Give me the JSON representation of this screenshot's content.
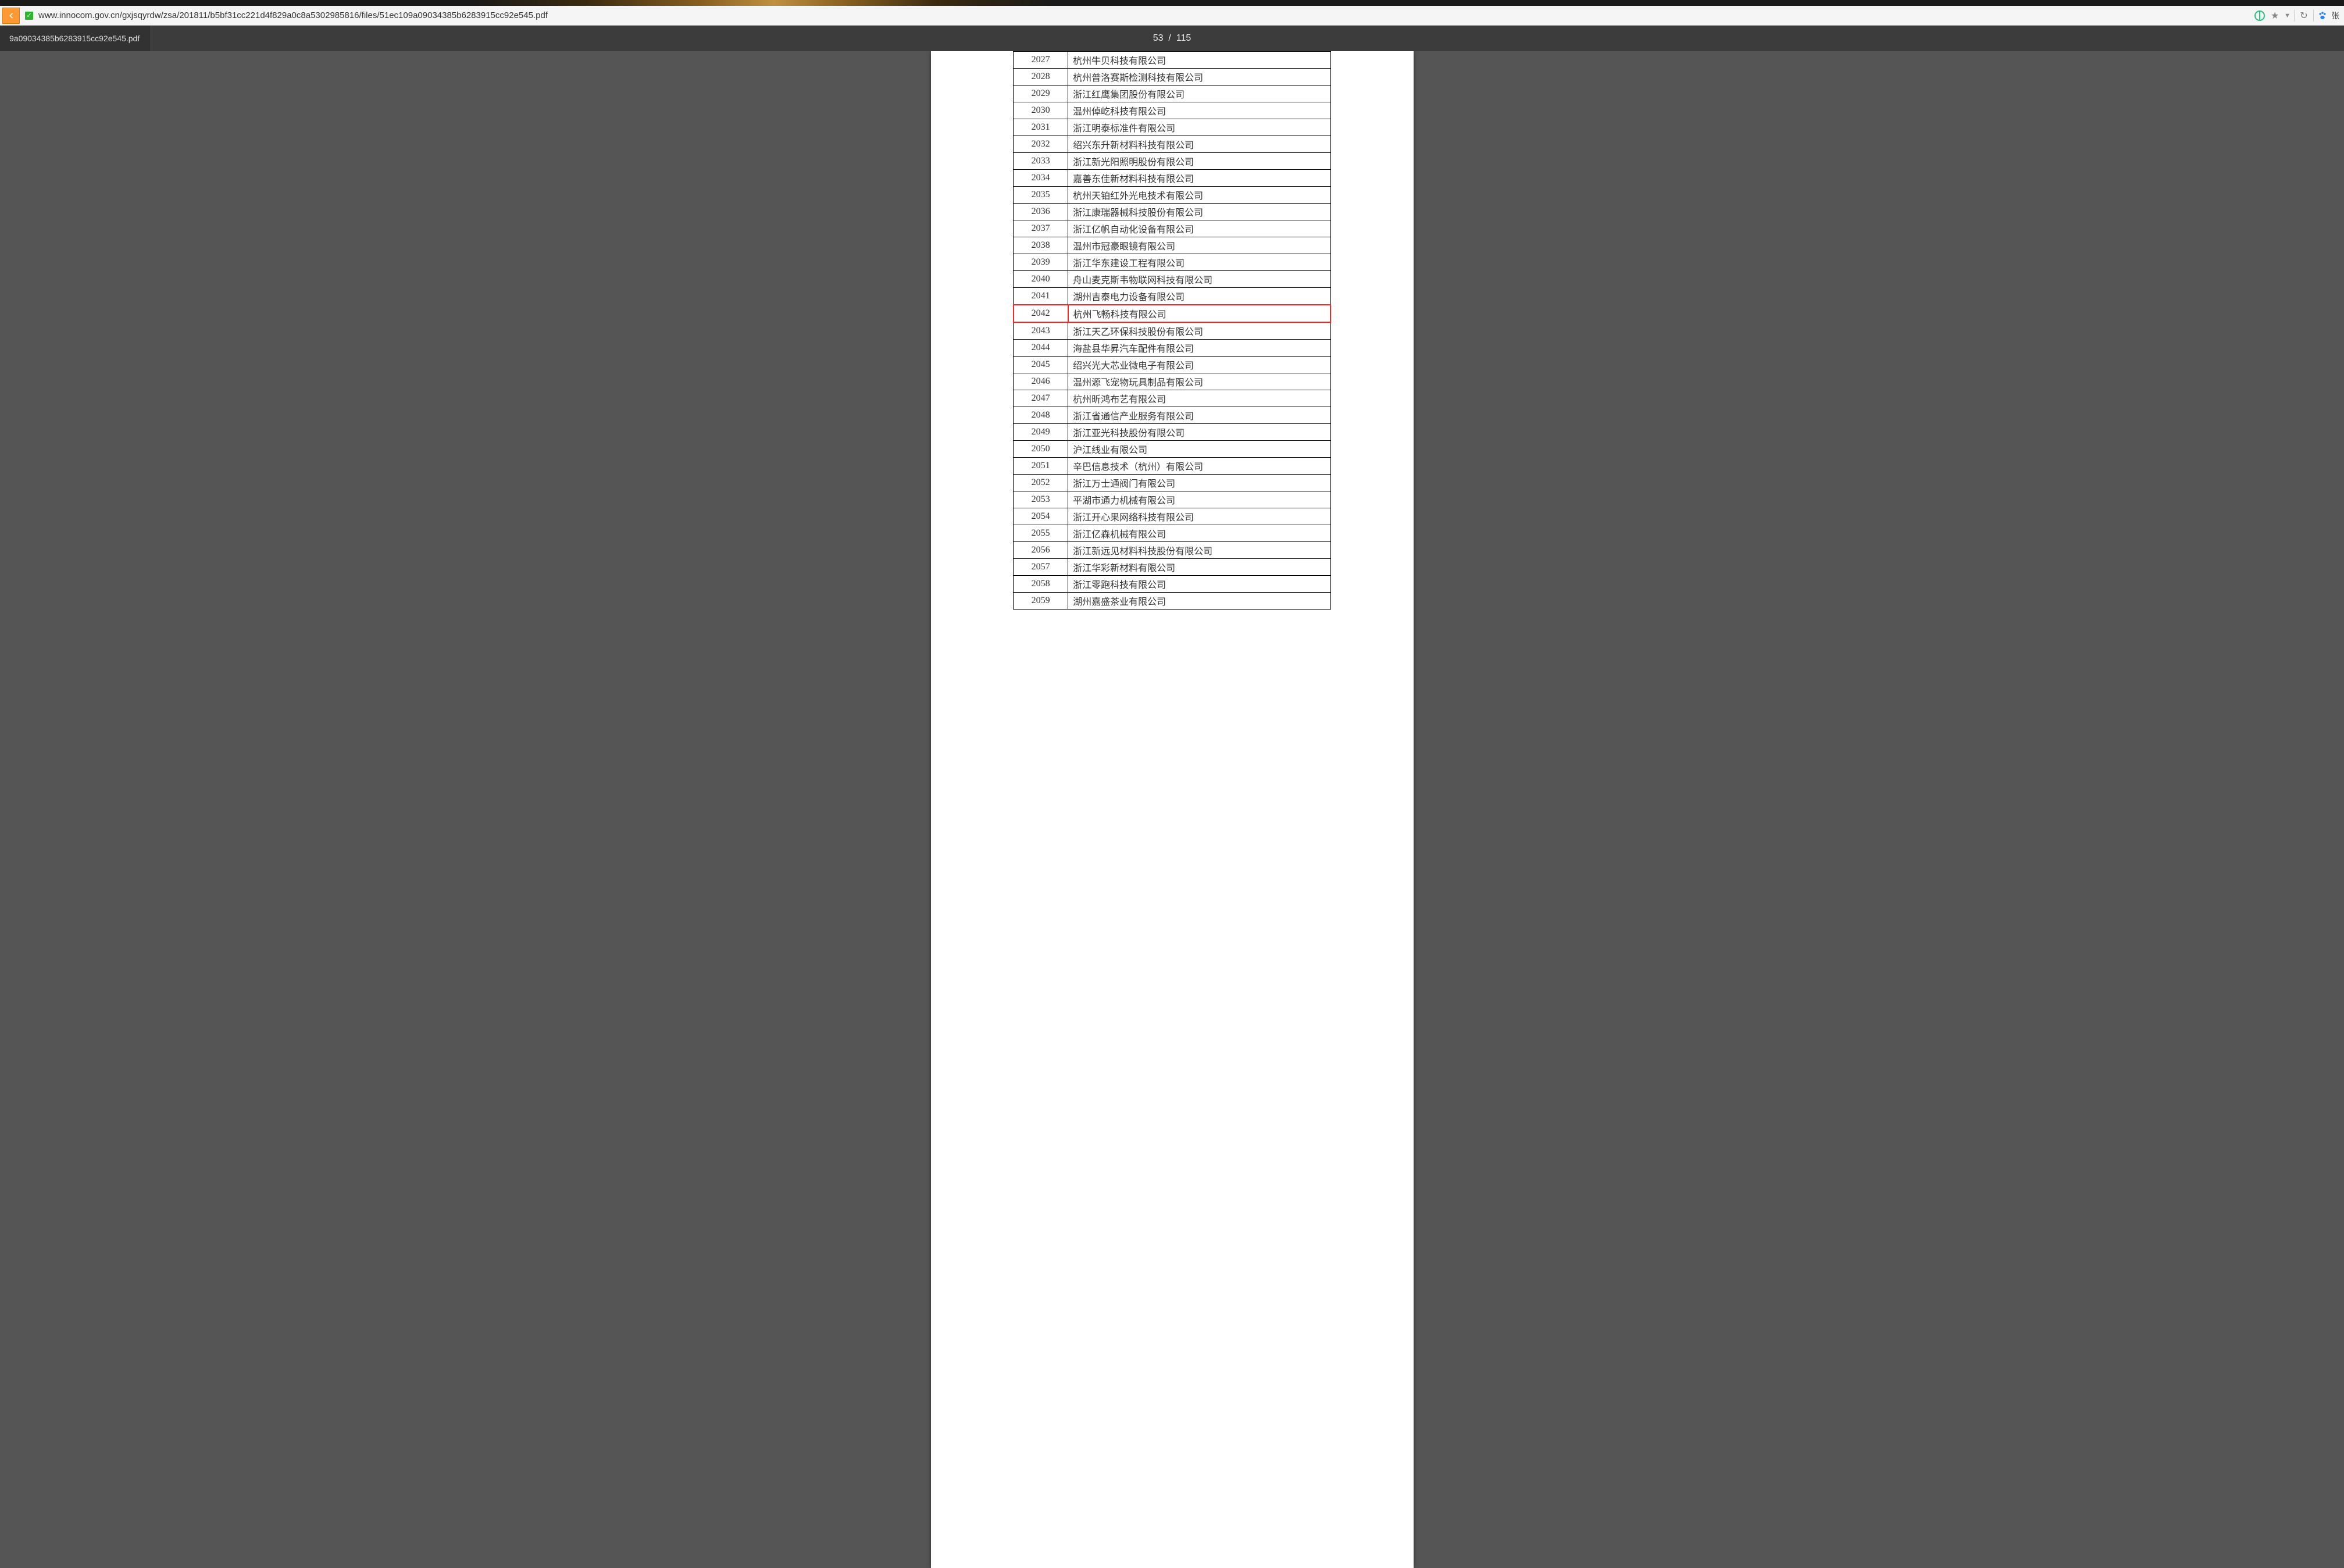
{
  "browser": {
    "url_display": "www.innocom.gov.cn/gxjsqyrdw/zsa/201811/b5bf31cc221d4f829a0c8a5302985816/files/51ec109a09034385b6283915cc92e545.pdf",
    "user_label": "张"
  },
  "pdf": {
    "tab_title": "9a09034385b6283915cc92e545.pdf",
    "current_page": "53",
    "total_pages": "115"
  },
  "rows": [
    {
      "num": "2027",
      "name": "杭州牛贝科技有限公司"
    },
    {
      "num": "2028",
      "name": "杭州普洛赛斯检测科技有限公司"
    },
    {
      "num": "2029",
      "name": "浙江红鹰集团股份有限公司"
    },
    {
      "num": "2030",
      "name": "温州倬屹科技有限公司"
    },
    {
      "num": "2031",
      "name": "浙江明泰标准件有限公司"
    },
    {
      "num": "2032",
      "name": "绍兴东升新材料科技有限公司"
    },
    {
      "num": "2033",
      "name": "浙江新光阳照明股份有限公司"
    },
    {
      "num": "2034",
      "name": "嘉善东佳新材料科技有限公司"
    },
    {
      "num": "2035",
      "name": "杭州天铂红外光电技术有限公司"
    },
    {
      "num": "2036",
      "name": "浙江康瑞器械科技股份有限公司"
    },
    {
      "num": "2037",
      "name": "浙江亿帆自动化设备有限公司"
    },
    {
      "num": "2038",
      "name": "温州市冠豪眼镜有限公司"
    },
    {
      "num": "2039",
      "name": "浙江华东建设工程有限公司"
    },
    {
      "num": "2040",
      "name": "舟山麦克斯韦物联网科技有限公司"
    },
    {
      "num": "2041",
      "name": "湖州吉泰电力设备有限公司"
    },
    {
      "num": "2042",
      "name": "杭州飞畅科技有限公司",
      "highlight": true
    },
    {
      "num": "2043",
      "name": "浙江天乙环保科技股份有限公司"
    },
    {
      "num": "2044",
      "name": "海盐县华昇汽车配件有限公司"
    },
    {
      "num": "2045",
      "name": "绍兴光大芯业微电子有限公司"
    },
    {
      "num": "2046",
      "name": "温州源飞宠物玩具制品有限公司"
    },
    {
      "num": "2047",
      "name": "杭州昕鸿布艺有限公司"
    },
    {
      "num": "2048",
      "name": "浙江省通信产业服务有限公司"
    },
    {
      "num": "2049",
      "name": "浙江亚光科技股份有限公司"
    },
    {
      "num": "2050",
      "name": "沪江线业有限公司"
    },
    {
      "num": "2051",
      "name": "辛巴信息技术（杭州）有限公司"
    },
    {
      "num": "2052",
      "name": "浙江万士通阀门有限公司"
    },
    {
      "num": "2053",
      "name": "平湖市通力机械有限公司"
    },
    {
      "num": "2054",
      "name": "浙江开心果网络科技有限公司"
    },
    {
      "num": "2055",
      "name": "浙江亿森机械有限公司"
    },
    {
      "num": "2056",
      "name": "浙江新远见材料科技股份有限公司"
    },
    {
      "num": "2057",
      "name": "浙江华彩新材料有限公司"
    },
    {
      "num": "2058",
      "name": "浙江零跑科技有限公司"
    },
    {
      "num": "2059",
      "name": "湖州嘉盛茶业有限公司"
    }
  ]
}
